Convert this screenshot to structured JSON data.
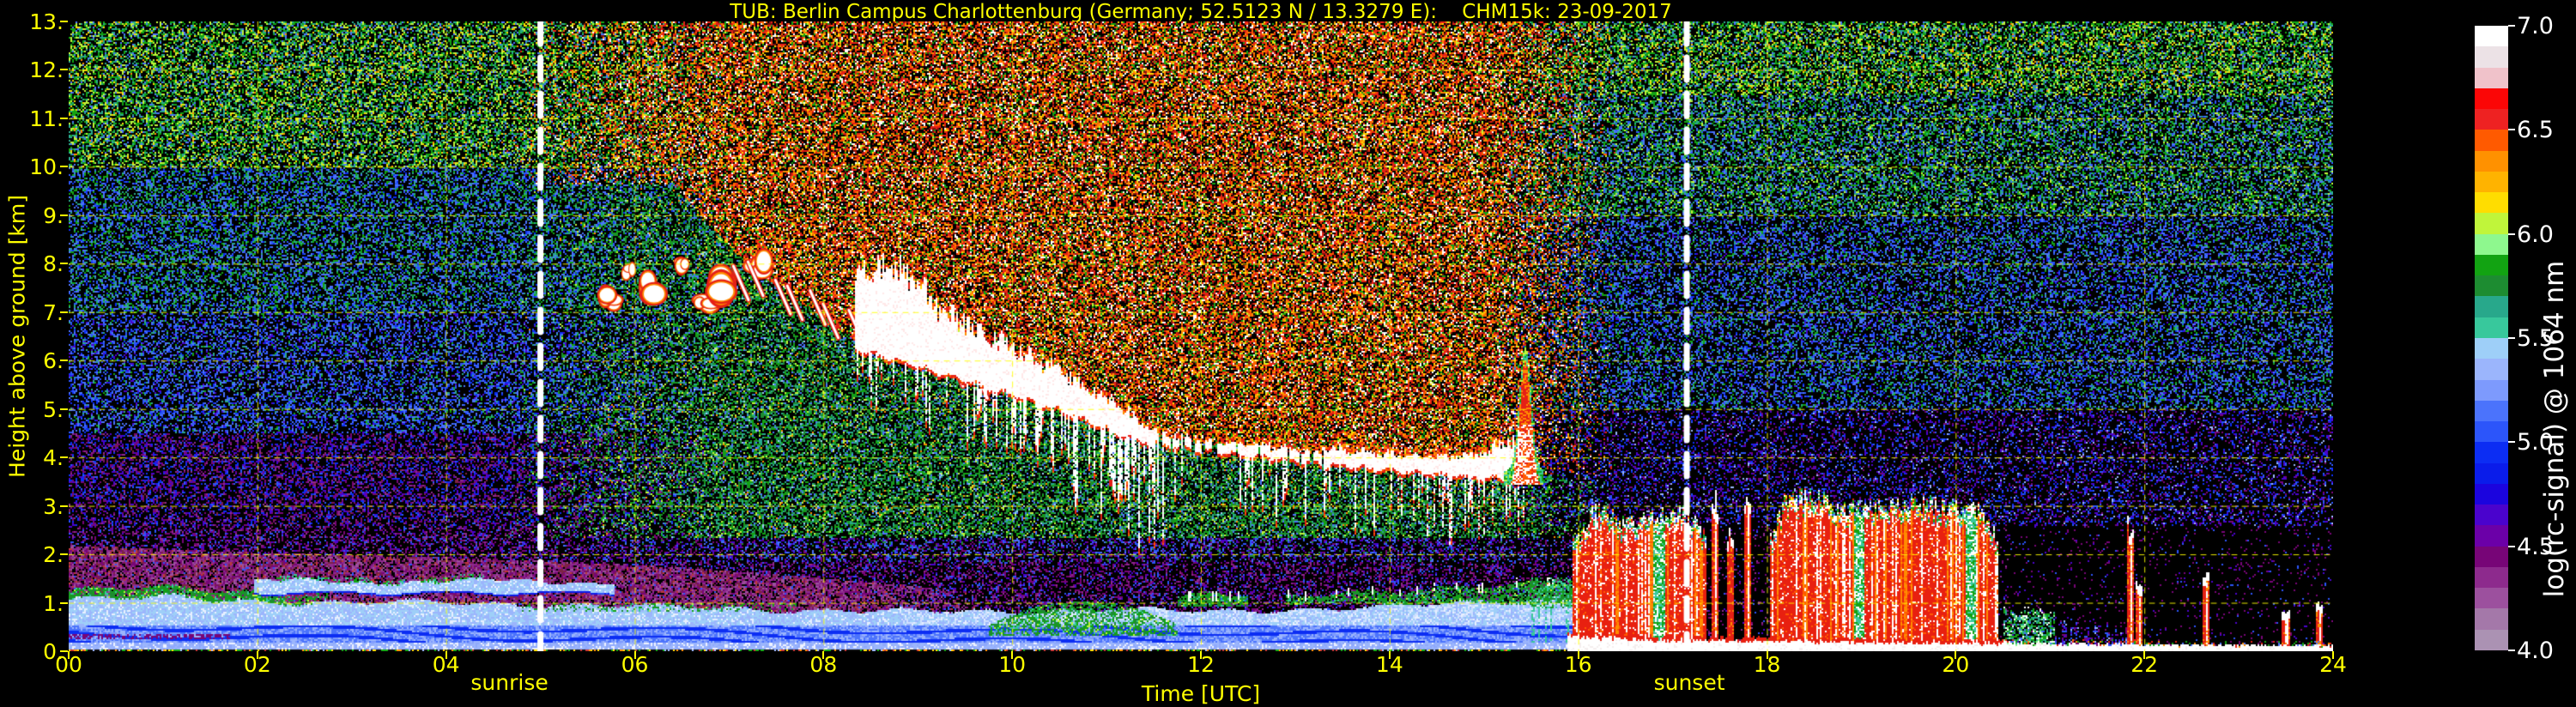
{
  "title": "TUB: Berlin Campus Charlottenburg (Germany; 52.5123 N / 13.3279 E):    CHM15k: 23-09-2017",
  "axes": {
    "x_label": "Time [UTC]",
    "y_label": "Height above ground [km]",
    "x_tick_labels": [
      "00",
      "02",
      "04",
      "06",
      "08",
      "10",
      "12",
      "14",
      "16",
      "18",
      "20",
      "22",
      "24"
    ],
    "x_tick_hours": [
      0,
      2,
      4,
      6,
      8,
      10,
      12,
      14,
      16,
      18,
      20,
      22,
      24
    ],
    "y_tick_labels": [
      "0.",
      "1.",
      "2.",
      "3.",
      "4.",
      "5.",
      "6.",
      "7.",
      "8.",
      "9.",
      "10.",
      "11.",
      "12.",
      "13."
    ],
    "y_tick_km": [
      0,
      1,
      2,
      3,
      4,
      5,
      6,
      7,
      8,
      9,
      10,
      11,
      12,
      13
    ],
    "x_range_hours": [
      0,
      24
    ],
    "y_range_km": [
      0,
      13
    ],
    "text_color": "#ffff00",
    "grid_color": "#ffff00",
    "grid_dashed": true
  },
  "annotations": {
    "sunrise_label": "sunrise",
    "sunset_label": "sunset",
    "sunrise_utc": 5.0,
    "sunset_utc": 17.15,
    "line_color": "#ffffff"
  },
  "colorbar": {
    "label": "log(rc-signal) @ 1064 nm",
    "tick_labels": [
      "7.0",
      "6.5",
      "6.0",
      "5.5",
      "5.0",
      "4.5",
      "4.0"
    ],
    "value_range": [
      4.0,
      7.0
    ],
    "text_color": "#ffffff",
    "colors_bottom_to_top": [
      "#ab92b3",
      "#a478a9",
      "#9c509e",
      "#8d2a8d",
      "#770577",
      "#6b00a8",
      "#4a03cd",
      "#1b04de",
      "#0a1cea",
      "#0c2df3",
      "#2c55fa",
      "#4b73fc",
      "#7d9afd",
      "#9bb5fc",
      "#9ecff8",
      "#38c89c",
      "#28a88b",
      "#1d8c31",
      "#12a312",
      "#8ef88e",
      "#c0f53a",
      "#ffdd00",
      "#ffb300",
      "#ff9100",
      "#ff5a00",
      "#ee2222",
      "#fb0606",
      "#f0c2ca",
      "#ece2e6",
      "#ffffff"
    ]
  },
  "chart_data": {
    "type": "heatmap",
    "title": "TUB: Berlin Campus Charlottenburg (Germany; 52.5123 N / 13.3279 E):    CHM15k: 23-09-2017",
    "xlabel": "Time [UTC]",
    "ylabel": "Height above ground [km]",
    "zlabel": "log(rc-signal) @ 1064 nm",
    "xlim_hours": [
      0,
      24
    ],
    "ylim_km": [
      0,
      13
    ],
    "zlim": [
      4.0,
      7.0
    ],
    "grid": true,
    "features": {
      "sunrise_utc": 5.0,
      "sunset_utc": 17.15,
      "boundary_layer_top_km": [
        [
          0,
          1.07
        ],
        [
          1,
          1.12
        ],
        [
          2,
          1.05
        ],
        [
          3,
          0.97
        ],
        [
          4,
          1.0
        ],
        [
          5,
          0.95
        ],
        [
          6,
          0.9
        ],
        [
          7,
          0.87
        ],
        [
          8,
          0.82
        ],
        [
          9,
          0.8
        ],
        [
          10,
          0.82
        ],
        [
          11,
          0.85
        ],
        [
          12,
          0.8
        ],
        [
          13,
          0.85
        ],
        [
          14,
          0.9
        ],
        [
          15,
          1.0
        ],
        [
          16,
          1.1
        ]
      ],
      "residual_haze_top_km": [
        [
          0,
          2.2
        ],
        [
          2,
          2.05
        ],
        [
          4,
          1.95
        ],
        [
          6,
          1.8
        ],
        [
          7.5,
          1.6
        ],
        [
          9,
          1.35
        ],
        [
          9.8,
          1.2
        ]
      ],
      "elevated_layer": {
        "t0": 1.95,
        "t1": 5.78,
        "base_km": 1.2,
        "top_km": 1.45
      },
      "green_cap": {
        "t0": 0,
        "t1": 2.75,
        "thickness_km": 0.17
      },
      "cloud_base_km": [
        [
          8.35,
          6.25
        ],
        [
          9.0,
          5.9
        ],
        [
          9.5,
          5.6
        ],
        [
          10.0,
          5.3
        ],
        [
          10.5,
          5.0
        ],
        [
          11.0,
          4.6
        ],
        [
          11.4,
          4.35
        ],
        [
          12.0,
          4.15
        ],
        [
          12.6,
          4.05
        ],
        [
          13.2,
          3.9
        ],
        [
          14.0,
          3.75
        ],
        [
          14.7,
          3.65
        ],
        [
          15.35,
          3.55
        ]
      ],
      "cloud_thickness_km": [
        [
          8.35,
          1.7
        ],
        [
          8.8,
          1.9
        ],
        [
          9.3,
          1.25
        ],
        [
          10.0,
          0.95
        ],
        [
          10.6,
          0.8
        ],
        [
          11.1,
          0.55
        ],
        [
          11.45,
          0.3
        ],
        [
          12.0,
          0.22
        ],
        [
          12.7,
          0.28
        ],
        [
          13.3,
          0.3
        ],
        [
          14.0,
          0.32
        ],
        [
          14.6,
          0.35
        ],
        [
          15.0,
          0.5
        ],
        [
          15.3,
          0.8
        ]
      ],
      "early_clouds_t_h_w_hgt": [
        [
          5.75,
          7.3,
          0.18,
          0.5
        ],
        [
          5.95,
          7.85,
          0.12,
          0.35
        ],
        [
          6.2,
          7.5,
          0.25,
          0.7
        ],
        [
          6.5,
          7.95,
          0.15,
          0.4
        ],
        [
          6.75,
          7.25,
          0.2,
          0.5
        ],
        [
          7.0,
          7.6,
          0.3,
          0.8
        ],
        [
          7.3,
          7.95,
          0.2,
          0.55
        ]
      ],
      "fallstreaks": {
        "t0": 7.0,
        "h0": 7.8,
        "t1": 9.7,
        "h1": 5.6,
        "count": 14
      },
      "updraft_plume": {
        "t": 15.43,
        "h_top": 6.3,
        "h_base": 3.45
      },
      "rain_blocks_top_km": [
        [
          [
            15.95,
            2.2
          ],
          [
            16.15,
            2.9
          ],
          [
            16.5,
            2.6
          ],
          [
            16.8,
            2.75
          ],
          [
            17.1,
            2.9
          ],
          [
            17.35,
            2.4
          ]
        ],
        [
          [
            18.05,
            2.4
          ],
          [
            18.2,
            3.15
          ],
          [
            18.5,
            3.2
          ],
          [
            18.8,
            2.9
          ],
          [
            19.2,
            3.0
          ],
          [
            19.6,
            3.05
          ],
          [
            20.0,
            2.95
          ],
          [
            20.3,
            2.85
          ],
          [
            20.45,
            2.2
          ]
        ]
      ],
      "rain_spikes_t_h": [
        [
          17.45,
          3.05
        ],
        [
          17.62,
          2.4
        ],
        [
          17.8,
          3.1
        ],
        [
          21.85,
          2.55
        ],
        [
          21.95,
          1.4
        ],
        [
          22.65,
          1.55
        ],
        [
          23.5,
          0.8
        ],
        [
          23.85,
          1.0
        ]
      ],
      "drizzle_column": {
        "t0": 20.5,
        "t1": 21.05,
        "top_km": 0.85
      },
      "faint_columns": {
        "t0": 21.05,
        "t1": 21.85,
        "max_top_km": 0.65
      },
      "ground_layer_top_km": [
        [
          15.9,
          0.3
        ],
        [
          16.5,
          0.25
        ],
        [
          18,
          0.2
        ],
        [
          20.5,
          0.16
        ],
        [
          22,
          0.12
        ],
        [
          24,
          0.1
        ]
      ]
    }
  }
}
